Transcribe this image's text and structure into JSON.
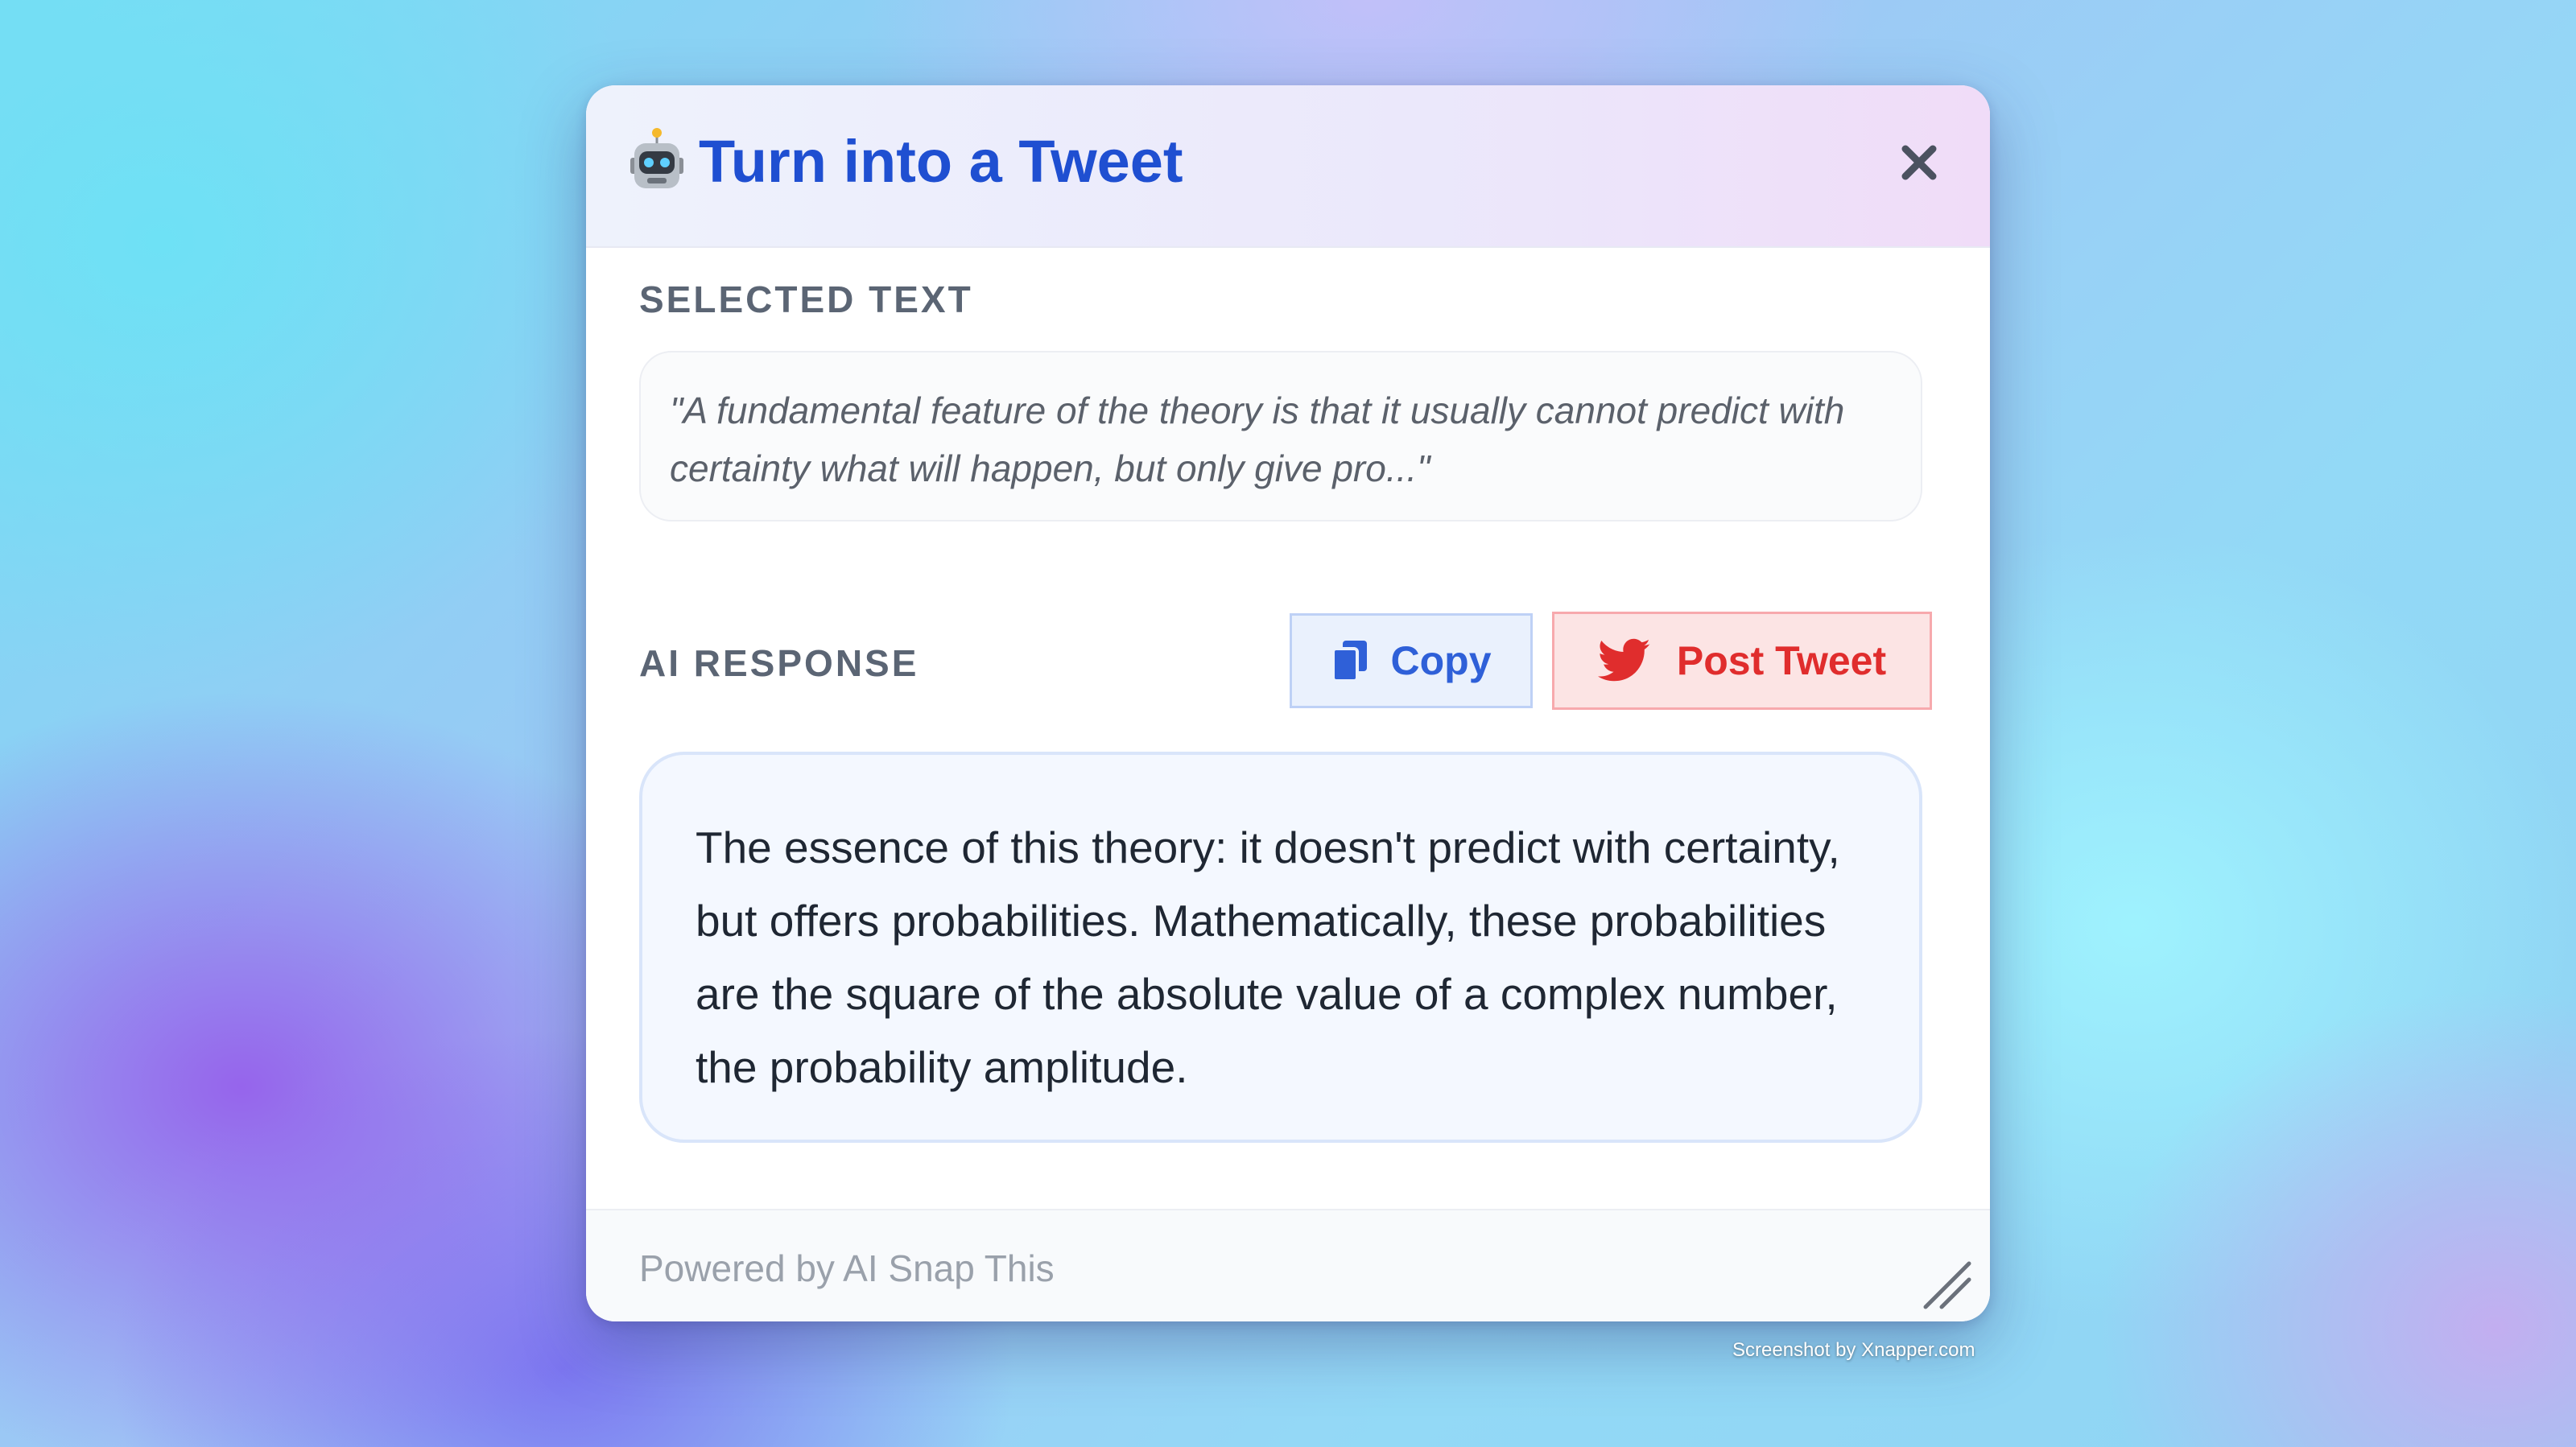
{
  "dialog": {
    "title": "Turn into a Tweet",
    "title_icon": "robot-icon",
    "close_icon": "close-icon"
  },
  "selected": {
    "label": "SELECTED TEXT",
    "text": "\"A fundamental feature of the theory is that it usually cannot predict with certainty what will happen, but only give pro...\""
  },
  "response": {
    "label": "AI RESPONSE",
    "text": "The essence of this theory: it doesn't predict with certainty, but offers probabilities. Mathematically, these probabilities are the square of the absolute value of a complex number, the probability amplitude.",
    "copy_label": "Copy",
    "copy_icon": "copy-icon",
    "tweet_label": "Post Tweet",
    "tweet_icon": "twitter-bird-icon"
  },
  "footer": {
    "text": "Powered by AI Snap This"
  },
  "watermark": "Screenshot by Xnapper.com",
  "colors": {
    "title": "#1f4fd1",
    "copy_accent": "#2f60d8",
    "tweet_accent": "#e02d2d"
  }
}
